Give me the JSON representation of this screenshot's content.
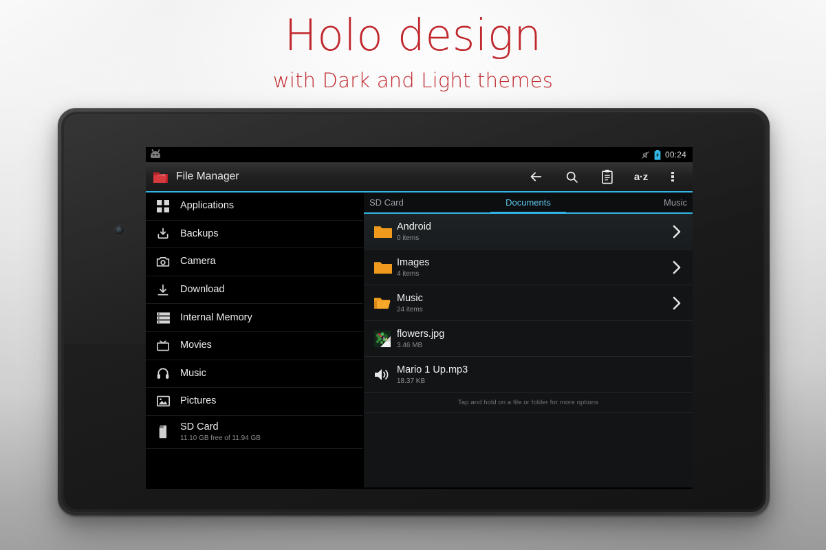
{
  "promo": {
    "headline": "Holo design",
    "subheadline": "with Dark and Light themes",
    "accent_color": "#c0272d"
  },
  "device": {
    "name": "android-tablet",
    "front_camera": "front-camera",
    "light_sensor": "light-sensor"
  },
  "statusbar": {
    "notification_icon": "android-notification-icon",
    "vibrate_icon": "vibrate-mute-icon",
    "battery_icon": "battery-charging-icon",
    "battery_color": "#33b5e5",
    "time": "00:24"
  },
  "actionbar": {
    "app_icon": "red-folder-icon",
    "title": "File Manager",
    "accent_color": "#33b5e5",
    "actions": [
      {
        "name": "back-button",
        "icon": "arrow-left-icon",
        "label": ""
      },
      {
        "name": "search-button",
        "icon": "search-icon",
        "label": ""
      },
      {
        "name": "clipboard-button",
        "icon": "clipboard-icon",
        "label": ""
      },
      {
        "name": "sort-button",
        "icon": "az-sort-icon",
        "label": "a·z"
      },
      {
        "name": "overflow-button",
        "icon": "more-vertical-icon",
        "label": ""
      }
    ]
  },
  "sidebar": {
    "items": [
      {
        "label": "Applications",
        "sub": "",
        "icon": "grid-apps-icon"
      },
      {
        "label": "Backups",
        "sub": "",
        "icon": "backup-download-icon"
      },
      {
        "label": "Camera",
        "sub": "",
        "icon": "camera-icon"
      },
      {
        "label": "Download",
        "sub": "",
        "icon": "download-icon"
      },
      {
        "label": "Internal Memory",
        "sub": "",
        "icon": "storage-icon"
      },
      {
        "label": "Movies",
        "sub": "",
        "icon": "tv-movies-icon"
      },
      {
        "label": "Music",
        "sub": "",
        "icon": "headphones-icon"
      },
      {
        "label": "Pictures",
        "sub": "",
        "icon": "picture-icon"
      },
      {
        "label": "SD Card",
        "sub": "11.10 GB free of 11.94 GB",
        "icon": "sd-card-icon"
      }
    ]
  },
  "content": {
    "tabs": [
      {
        "label": "SD Card",
        "active": false
      },
      {
        "label": "Documents",
        "active": true
      },
      {
        "label": "Music",
        "active": false
      }
    ],
    "folder_color": "#f09a1e",
    "files": [
      {
        "name": "Android",
        "sub": "0 items",
        "icon": "folder-icon",
        "chevron": true,
        "selected": true
      },
      {
        "name": "Images",
        "sub": "4 items",
        "icon": "folder-icon",
        "chevron": true,
        "selected": false
      },
      {
        "name": "Music",
        "sub": "24 items",
        "icon": "folder-open-icon",
        "chevron": true,
        "selected": false
      },
      {
        "name": "flowers.jpg",
        "sub": "3.46 MB",
        "icon": "image-thumbnail",
        "chevron": false,
        "selected": false
      },
      {
        "name": "Mario 1 Up.mp3",
        "sub": "18.37 KB",
        "icon": "audio-speaker-icon",
        "chevron": false,
        "selected": false
      }
    ],
    "hint": "Tap and hold on a file or folder for more options"
  },
  "navbar": {
    "buttons": [
      {
        "name": "system-back-button",
        "icon": "back-arrow-icon"
      },
      {
        "name": "system-home-button",
        "icon": "home-icon"
      },
      {
        "name": "system-recents-button",
        "icon": "recents-icon"
      }
    ]
  }
}
